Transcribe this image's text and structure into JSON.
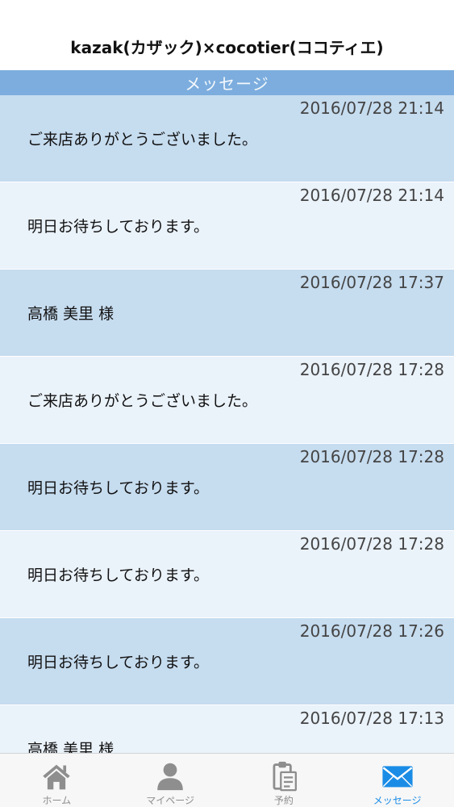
{
  "header": {
    "title": "kazak(カザック)×cocotier(ココティエ)"
  },
  "section": {
    "title": "メッセージ"
  },
  "messages": [
    {
      "time": "2016/07/28 21:14",
      "text": "ご来店ありがとうございました。"
    },
    {
      "time": "2016/07/28 21:14",
      "text": "明日お待ちしております。"
    },
    {
      "time": "2016/07/28 17:37",
      "text": "高橋 美里 様"
    },
    {
      "time": "2016/07/28 17:28",
      "text": "ご来店ありがとうございました。"
    },
    {
      "time": "2016/07/28 17:28",
      "text": "明日お待ちしております。"
    },
    {
      "time": "2016/07/28 17:28",
      "text": "明日お待ちしております。"
    },
    {
      "time": "2016/07/28 17:26",
      "text": "明日お待ちしております。"
    },
    {
      "time": "2016/07/28 17:13",
      "text": "高橋 美里 様"
    }
  ],
  "tabbar": {
    "items": [
      {
        "label": "ホーム",
        "icon": "home-icon",
        "active": false
      },
      {
        "label": "マイページ",
        "icon": "person-icon",
        "active": false
      },
      {
        "label": "予約",
        "icon": "clipboard-icon",
        "active": false
      },
      {
        "label": "メッセージ",
        "icon": "envelope-icon",
        "active": true
      }
    ]
  },
  "colors": {
    "section_bar": "#7cadde",
    "row_dark": "#c6dcef",
    "row_light": "#eaf2fa",
    "active_tab": "#1a8ce6",
    "inactive_tab": "#8e8e8e"
  }
}
